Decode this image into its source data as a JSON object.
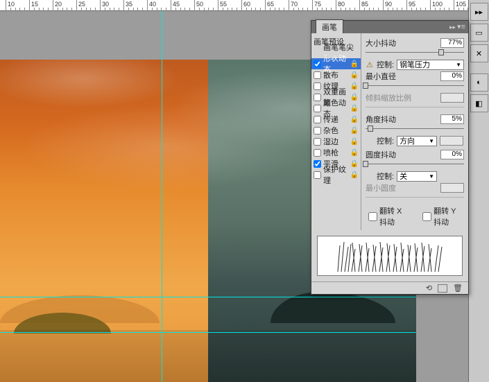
{
  "ruler": {
    "ticks": [
      10,
      15,
      20,
      25,
      30,
      35,
      40,
      45,
      50,
      55,
      60,
      65,
      70,
      75,
      80,
      85,
      90,
      95,
      100,
      105
    ]
  },
  "panel": {
    "title": "画笔",
    "options": {
      "preset": "画笔预设",
      "tip": "画笔笔尖形状",
      "shape_dynamics": "形状动态",
      "scattering": "散布",
      "texture": "纹理",
      "dual_brush": "双重画笔",
      "color_dynamics": "颜色动态",
      "transfer": "传递",
      "noise": "杂色",
      "wet_edges": "湿边",
      "airbrush": "喷枪",
      "smoothing": "平滑",
      "protect_texture": "保护纹理"
    },
    "controls": {
      "size_jitter": {
        "label": "大小抖动",
        "value": "77%"
      },
      "control1": {
        "label": "控制:",
        "value": "钢笔压力"
      },
      "min_diameter": {
        "label": "最小直径",
        "value": "0%"
      },
      "tilt_scale": {
        "label": "倾斜缩放比例"
      },
      "angle_jitter": {
        "label": "角度抖动",
        "value": "5%"
      },
      "control2": {
        "label": "控制:",
        "value": "方向"
      },
      "roundness_jitter": {
        "label": "圆度抖动",
        "value": "0%"
      },
      "control3": {
        "label": "控制:",
        "value": "关"
      },
      "min_roundness": {
        "label": "最小圆度"
      },
      "flip_x": "翻转 X 抖动",
      "flip_y": "翻转 Y 抖动"
    }
  }
}
